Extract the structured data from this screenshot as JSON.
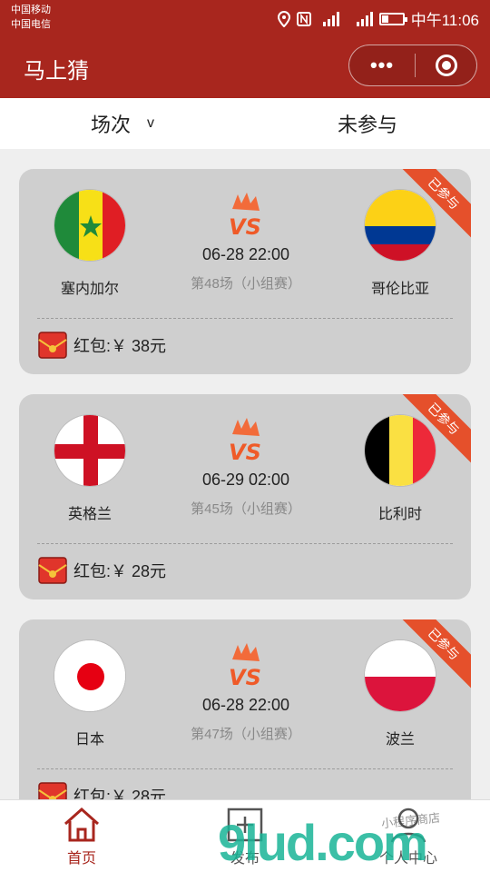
{
  "status_bar": {
    "carrier_1": "中国移动",
    "carrier_2": "中国电信",
    "time": "中午11:06",
    "icons": [
      "location-icon",
      "nfc-icon",
      "signal-2g-icon",
      "signal-4g-icon",
      "battery-icon"
    ]
  },
  "header": {
    "title": "马上猜",
    "more_glyph": "•••",
    "bg_color": "#a8261e"
  },
  "filters": {
    "round_label": "场次",
    "round_caret": "v",
    "status_label": "未参与"
  },
  "matches": [
    {
      "home": "塞内加尔",
      "home_flag": "senegal-flag",
      "away": "哥伦比亚",
      "away_flag": "colombia-flag",
      "time": "06-28 22:00",
      "round": "第48场（小组赛）",
      "reward_label": "红包:￥ 38元",
      "badge": "已参与"
    },
    {
      "home": "英格兰",
      "home_flag": "england-flag",
      "away": "比利时",
      "away_flag": "belgium-flag",
      "time": "06-29 02:00",
      "round": "第45场（小组赛）",
      "reward_label": "红包:￥ 28元",
      "badge": "已参与"
    },
    {
      "home": "日本",
      "home_flag": "japan-flag",
      "away": "波兰",
      "away_flag": "poland-flag",
      "time": "06-28 22:00",
      "round": "第47场（小组赛）",
      "reward_label": "红包:￥ 28元",
      "badge": "已参与"
    }
  ],
  "tabbar": {
    "home": "首页",
    "publish": "发布",
    "profile": "个人中心",
    "watermark": "9lud.com",
    "watermark_sub": "小程序商店"
  }
}
